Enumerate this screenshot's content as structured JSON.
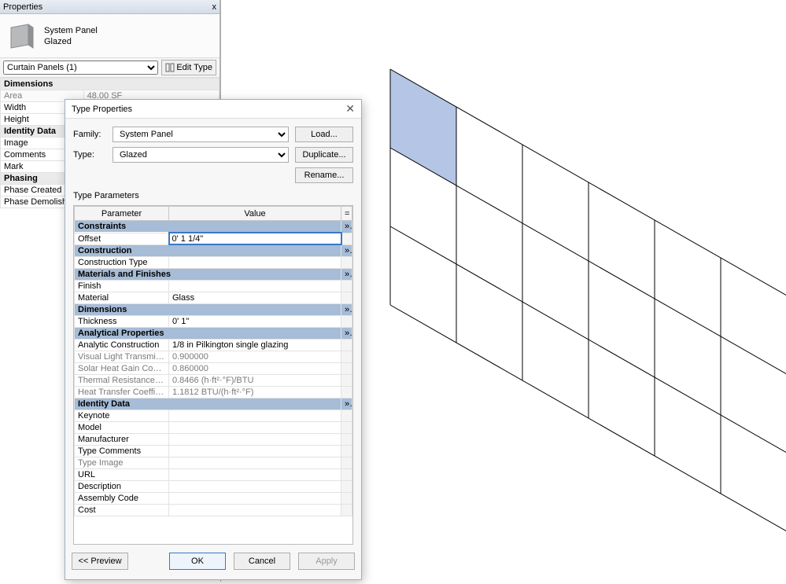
{
  "properties": {
    "title": "Properties",
    "close": "x",
    "thumb_title": "System Panel",
    "thumb_type": "Glazed",
    "selector": "Curtain Panels (1)",
    "edit_type": "Edit Type",
    "rows": [
      {
        "group": true,
        "label": "Dimensions",
        "expand": "a"
      },
      {
        "param": "Area",
        "value": "48.00 SF",
        "readonly": true
      },
      {
        "param": "Width",
        "value": ""
      },
      {
        "param": "Height",
        "value": ""
      },
      {
        "group": true,
        "label": "Identity Data",
        "expand": "a"
      },
      {
        "param": "Image",
        "value": ""
      },
      {
        "param": "Comments",
        "value": ""
      },
      {
        "param": "Mark",
        "value": ""
      },
      {
        "group": true,
        "label": "Phasing",
        "expand": "a"
      },
      {
        "param": "Phase Created",
        "value": ""
      },
      {
        "param": "Phase Demolished",
        "value": ""
      }
    ]
  },
  "dialog": {
    "title": "Type Properties",
    "family_label": "Family:",
    "family_value": "System Panel",
    "type_label": "Type:",
    "type_value": "Glazed",
    "btn_load": "Load...",
    "btn_duplicate": "Duplicate...",
    "btn_rename": "Rename...",
    "tp_label": "Type Parameters",
    "col_param": "Parameter",
    "col_value": "Value",
    "col_eq": "=",
    "groups": [
      {
        "name": "Constraints",
        "rows": [
          {
            "p": "Offset",
            "v": "0'  1 1/4\"",
            "sel": true
          }
        ]
      },
      {
        "name": "Construction",
        "rows": [
          {
            "p": "Construction Type",
            "v": ""
          }
        ]
      },
      {
        "name": "Materials and Finishes",
        "rows": [
          {
            "p": "Finish",
            "v": ""
          },
          {
            "p": "Material",
            "v": "Glass"
          }
        ]
      },
      {
        "name": "Dimensions",
        "rows": [
          {
            "p": "Thickness",
            "v": "0'  1\""
          }
        ]
      },
      {
        "name": "Analytical Properties",
        "rows": [
          {
            "p": "Analytic Construction",
            "v": "1/8 in Pilkington single glazing"
          },
          {
            "p": "Visual Light Transmittance",
            "v": "0.900000",
            "ro": true
          },
          {
            "p": "Solar Heat Gain Coefficient",
            "v": "0.860000",
            "ro": true
          },
          {
            "p": "Thermal Resistance (R)",
            "v": "0.8466 (h·ft²·°F)/BTU",
            "ro": true
          },
          {
            "p": "Heat Transfer Coefficient (U)",
            "v": "1.1812 BTU/(h·ft²·°F)",
            "ro": true
          }
        ]
      },
      {
        "name": "Identity Data",
        "rows": [
          {
            "p": "Keynote",
            "v": ""
          },
          {
            "p": "Model",
            "v": ""
          },
          {
            "p": "Manufacturer",
            "v": ""
          },
          {
            "p": "Type Comments",
            "v": ""
          },
          {
            "p": "Type Image",
            "v": "",
            "ro": true
          },
          {
            "p": "URL",
            "v": ""
          },
          {
            "p": "Description",
            "v": ""
          },
          {
            "p": "Assembly Code",
            "v": ""
          },
          {
            "p": "Cost",
            "v": ""
          }
        ]
      }
    ],
    "btn_preview": "<< Preview",
    "btn_ok": "OK",
    "btn_cancel": "Cancel",
    "btn_apply": "Apply"
  },
  "chart_data": {
    "type": "grid3d",
    "columns": 6,
    "rows": 3,
    "selected_cell": {
      "row": 0,
      "col": 0
    },
    "note": "isometric curtain wall panel grid; first panel top-left selected"
  }
}
